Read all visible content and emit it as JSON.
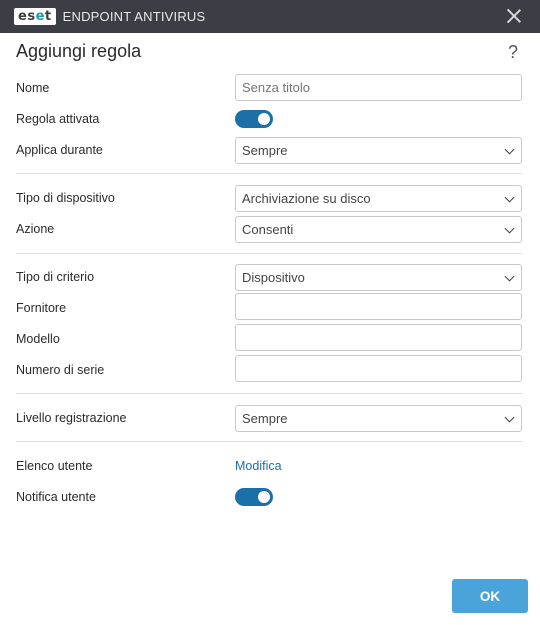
{
  "titlebar": {
    "logo_e1": "es",
    "logo_e2": "e",
    "logo_t": "t",
    "app_name": "ENDPOINT ANTIVIRUS"
  },
  "dialog": {
    "title": "Aggiungi regola",
    "help": "?"
  },
  "form": {
    "name_label": "Nome",
    "name_placeholder": "Senza titolo",
    "name_value": "",
    "rule_enabled_label": "Regola attivata",
    "rule_enabled": true,
    "apply_during_label": "Applica durante",
    "apply_during_value": "Sempre",
    "device_type_label": "Tipo di dispositivo",
    "device_type_value": "Archiviazione su disco",
    "action_label": "Azione",
    "action_value": "Consenti",
    "criteria_type_label": "Tipo di criterio",
    "criteria_type_value": "Dispositivo",
    "vendor_label": "Fornitore",
    "vendor_value": "",
    "model_label": "Modello",
    "model_value": "",
    "serial_label": "Numero di serie",
    "serial_value": "",
    "log_level_label": "Livello registrazione",
    "log_level_value": "Sempre",
    "user_list_label": "Elenco utente",
    "user_list_link": "Modifica",
    "user_notify_label": "Notifica utente",
    "user_notify": true
  },
  "footer": {
    "ok_label": "OK"
  },
  "colors": {
    "titlebar": "#3b3f45",
    "accent": "#1d6fa8",
    "ok_button": "#4aa3d9"
  },
  "icons": {
    "close": "close-icon",
    "help": "help-icon",
    "chevron": "chevron-down-icon"
  }
}
